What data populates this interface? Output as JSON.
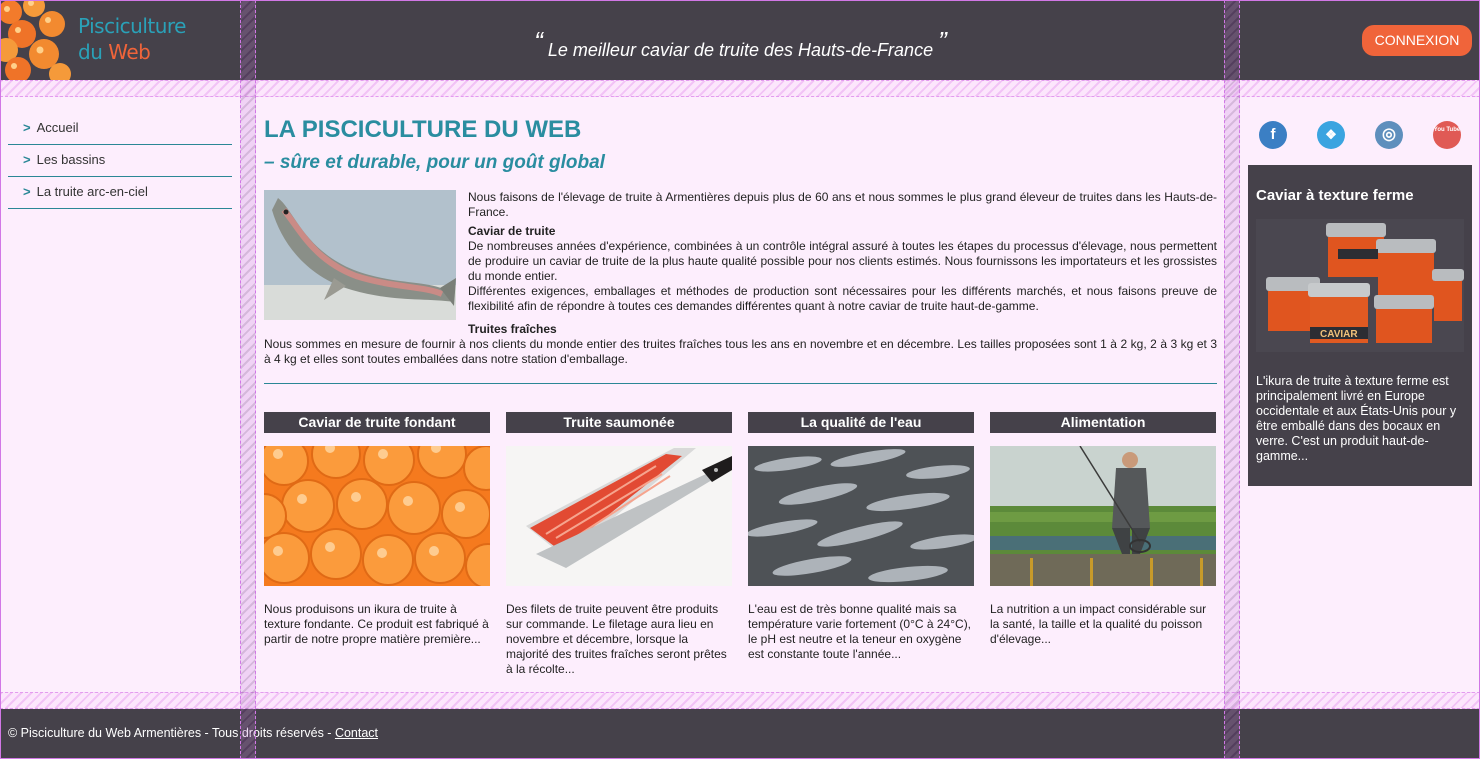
{
  "header": {
    "logo_line1": "Pisciculture",
    "logo_line2a": "du ",
    "logo_line2b": "Web",
    "tagline": "Le meilleur caviar de truite des Hauts-de-France",
    "quote_open": "“",
    "quote_close": "”",
    "login_label": "CONNEXION"
  },
  "nav": {
    "items": [
      {
        "chevron": ">",
        "label": "Accueil"
      },
      {
        "chevron": ">",
        "label": "Les bassins"
      },
      {
        "chevron": ">",
        "label": "La truite arc-en-ciel"
      }
    ]
  },
  "main": {
    "title": "LA PISCICULTURE DU WEB",
    "subtitle": "– sûre et durable, pour un goût global",
    "intro": "Nous faisons de l'élevage de truite à Armentières depuis plus de 60 ans et nous sommes le plus grand éleveur de truites dans les Hauts-de-France.",
    "caviar_heading": "Caviar de truite",
    "caviar_p1": "De nombreuses années d'expérience, combinées à un contrôle intégral assuré à toutes les étapes du processus d'élevage, nous permettent de produire un caviar de truite de la plus haute qualité possible pour nos clients estimés. Nous fournissons les importateurs et les grossistes du monde entier.",
    "caviar_p2": "Différentes exigences, emballages et méthodes de production sont nécessaires pour les différents marchés, et nous faisons preuve de flexibilité afin de répondre à toutes ces demandes différentes quant à notre caviar de truite haut-de-gamme.",
    "fresh_heading": "Truites fraîches",
    "fresh_p": "Nous sommes en mesure de fournir à nos clients du monde entier des truites fraîches tous les ans en novembre et en décembre. Les tailles proposées sont 1 à 2 kg, 2 à 3 kg et 3 à 4 kg et elles sont toutes emballées dans notre station d'emballage."
  },
  "cards": [
    {
      "title": "Caviar de truite fondant",
      "text": "Nous produisons un ikura de truite à texture fondante. Ce produit est fabriqué à partir de notre propre matière première..."
    },
    {
      "title": "Truite saumonée",
      "text": "Des filets de truite peuvent être produits sur commande. Le filetage aura lieu en novembre et décembre, lorsque la majorité des truites fraîches seront prêtes à la récolte..."
    },
    {
      "title": "La qualité de l'eau",
      "text": "L'eau est de très bonne qualité mais sa température varie fortement (0°C à 24°C), le pH est neutre et la teneur en oxygène est constante toute l'année..."
    },
    {
      "title": "Alimentation",
      "text": "La nutrition a un impact considérable sur la santé, la taille et la qualité du poisson d'élevage..."
    }
  ],
  "social": [
    {
      "icon": "facebook-icon",
      "glyph": "f",
      "color": "#3b7fc4"
    },
    {
      "icon": "twitter-icon",
      "glyph": "❖",
      "color": "#3aa4e0"
    },
    {
      "icon": "instagram-icon",
      "glyph": "◎",
      "color": "#5e8fbd"
    },
    {
      "icon": "youtube-icon",
      "glyph": "You Tube",
      "color": "#e05a55"
    }
  ],
  "aside": {
    "title": "Caviar à texture ferme",
    "text": "L'ikura de truite à texture ferme est principalement livré en Europe occidentale et aux États-Unis pour y être emballé dans des bocaux en verre. C'est un produit haut-de-gamme...",
    "jar_label": "CAVIAR"
  },
  "footer": {
    "text": "© Pisciculture du Web Armentières - Tous droits réservés - ",
    "contact_label": "Contact"
  },
  "colors": {
    "accent": "#2a8da0",
    "brand_orange": "#f0643a",
    "dark": "#45414a",
    "page_bg": "#fdeefd"
  }
}
